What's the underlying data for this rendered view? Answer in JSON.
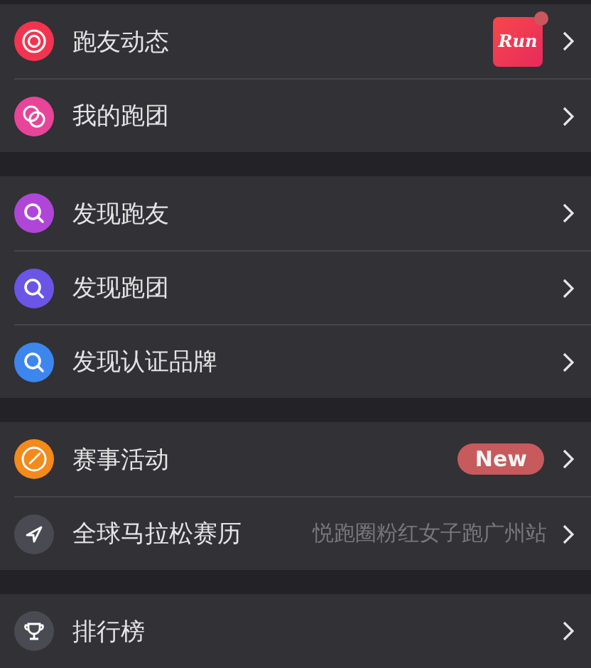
{
  "groups": [
    {
      "items": [
        {
          "kind": "feed",
          "label": "跑友动态",
          "color": "#f2344f",
          "app_badge": {
            "text": "Run",
            "dot": true
          }
        },
        {
          "kind": "clubs",
          "label": "我的跑团",
          "color": "#e8449a"
        }
      ]
    },
    {
      "items": [
        {
          "kind": "search",
          "label": "发现跑友",
          "color": "#b046d8"
        },
        {
          "kind": "search",
          "label": "发现跑团",
          "color": "#6a55e6"
        },
        {
          "kind": "search",
          "label": "发现认证品牌",
          "color": "#3d86ee"
        }
      ]
    },
    {
      "items": [
        {
          "kind": "compass",
          "label": "赛事活动",
          "color": "#f28a1c",
          "tag": "New"
        },
        {
          "kind": "navigate",
          "label": "全球马拉松赛历",
          "color": "#4a4b52",
          "detail": "悦跑圈粉红女子跑广州站"
        }
      ]
    },
    {
      "items": [
        {
          "kind": "trophy",
          "label": "排行榜",
          "color": "#4a4b52"
        }
      ]
    }
  ]
}
